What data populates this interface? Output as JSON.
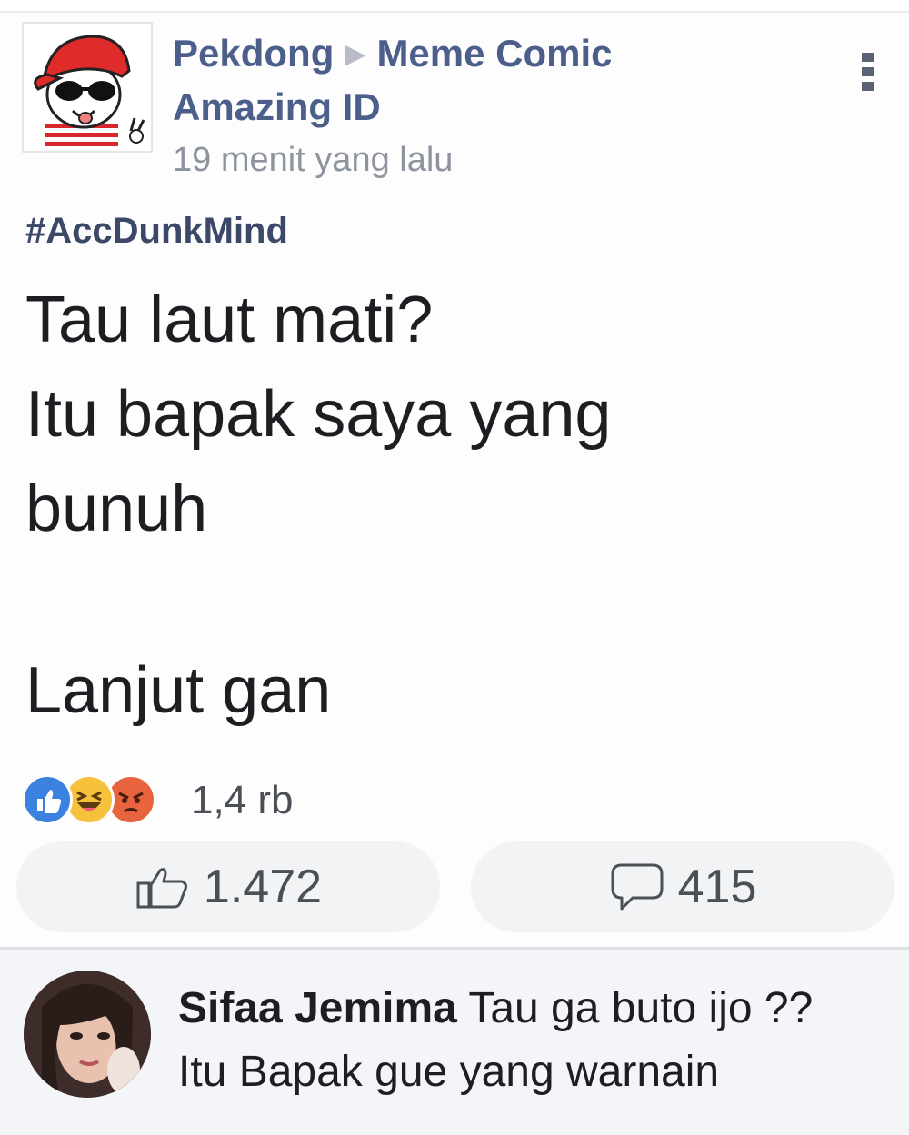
{
  "post": {
    "author": "Pekdong",
    "group_name_line1": "Meme Comic",
    "group_name_line2": "Amazing ID",
    "timestamp": "19 menit yang lalu",
    "hashtag": "#AccDunkMind",
    "body_lines": [
      "Tau laut mati?",
      "Itu bapak saya yang",
      "bunuh"
    ],
    "closing_line": "Lanjut gan",
    "reaction_summary": "1,4 rb",
    "reaction_icons": [
      "like-icon",
      "haha-icon",
      "angry-icon"
    ],
    "like_count": "1.472",
    "comment_count": "415"
  },
  "comment": {
    "author": "Sifaa Jemima",
    "text_line1": "Tau ga buto ijo ??",
    "text_line2": "Itu Bapak gue yang warnain"
  },
  "colors": {
    "author_link": "#4b5f8a",
    "like_blue": "#3b82e0",
    "haha_yellow": "#f7c23b",
    "angry_orange": "#e8643f",
    "pill_bg": "#f2f3f5"
  }
}
